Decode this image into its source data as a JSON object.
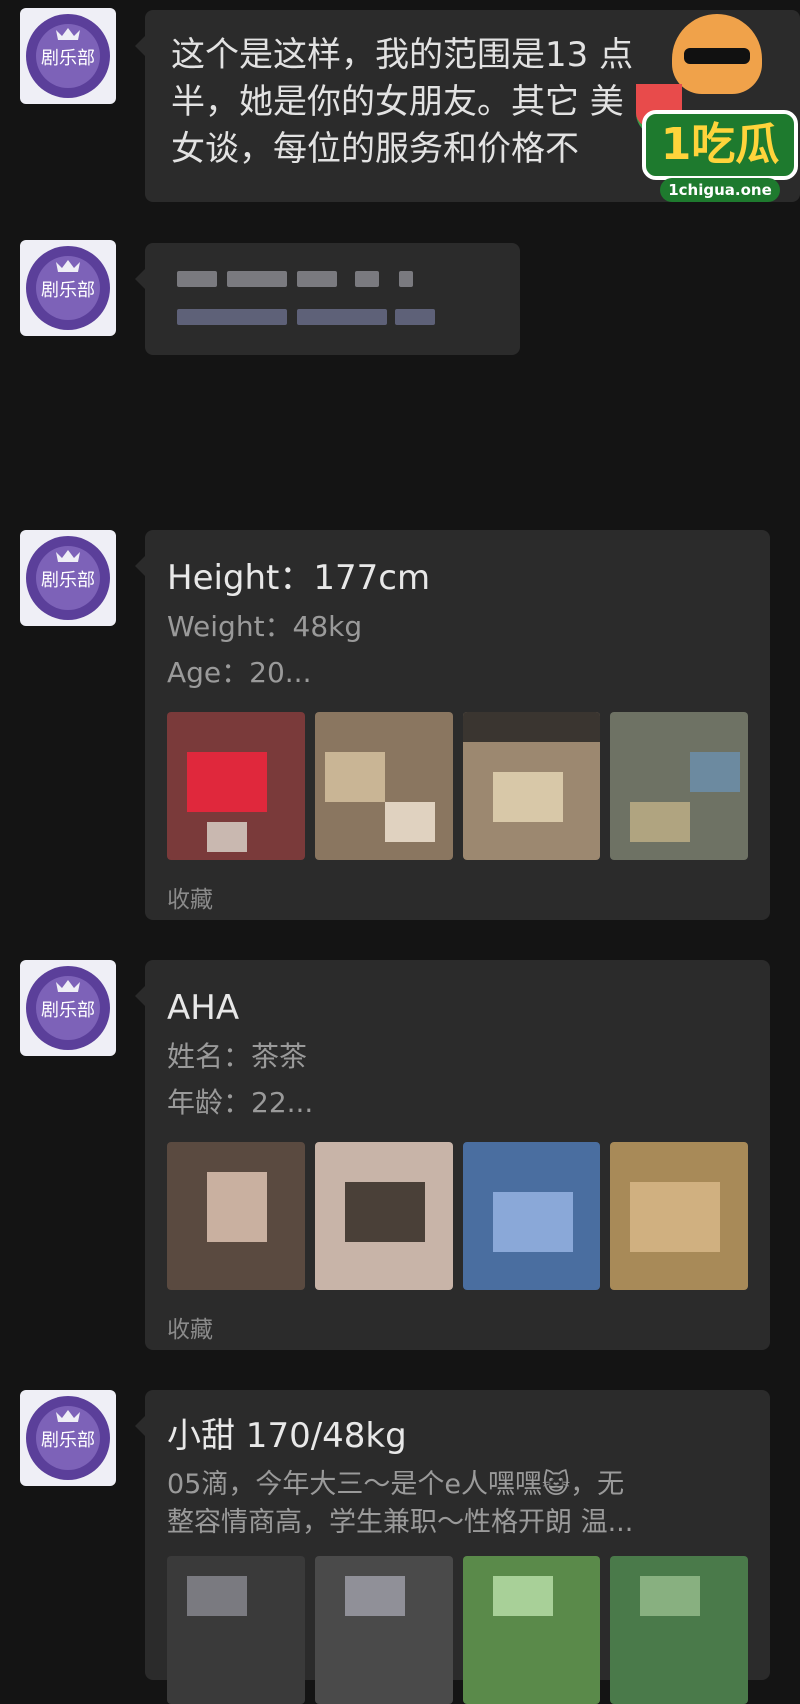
{
  "messages": [
    {
      "type": "text",
      "text": "这个是这样，我的范围是13 点\n半，她是你的女朋友。其它 美\n女谈，每位的服务和价格不"
    },
    {
      "type": "blurred"
    },
    {
      "type": "card",
      "title": "Height：177cm",
      "lines": [
        "Weight：48kg",
        "Age：20..."
      ],
      "thumbs": 4,
      "footer": "收藏"
    },
    {
      "type": "card",
      "title": "AHA",
      "lines": [
        "姓名：茶茶",
        "年龄：22..."
      ],
      "thumbs": 4,
      "footer": "收藏"
    },
    {
      "type": "card",
      "title": "小甜 170/48kg",
      "desc": "05滴，今年大三～是个e人嘿嘿😺，无\n整容情商高，学生兼职～性格开朗 温..."
    }
  ],
  "watermark": {
    "brand": "1吃瓜",
    "url": "1chigua.one"
  },
  "colors": {
    "background": "#141414",
    "bubble": "#2b2b2b",
    "avatar_ring": "#6a4fa8"
  },
  "icons": {
    "avatar": "club-crest-avatar",
    "watermark": "hamster-watermelon-logo"
  }
}
